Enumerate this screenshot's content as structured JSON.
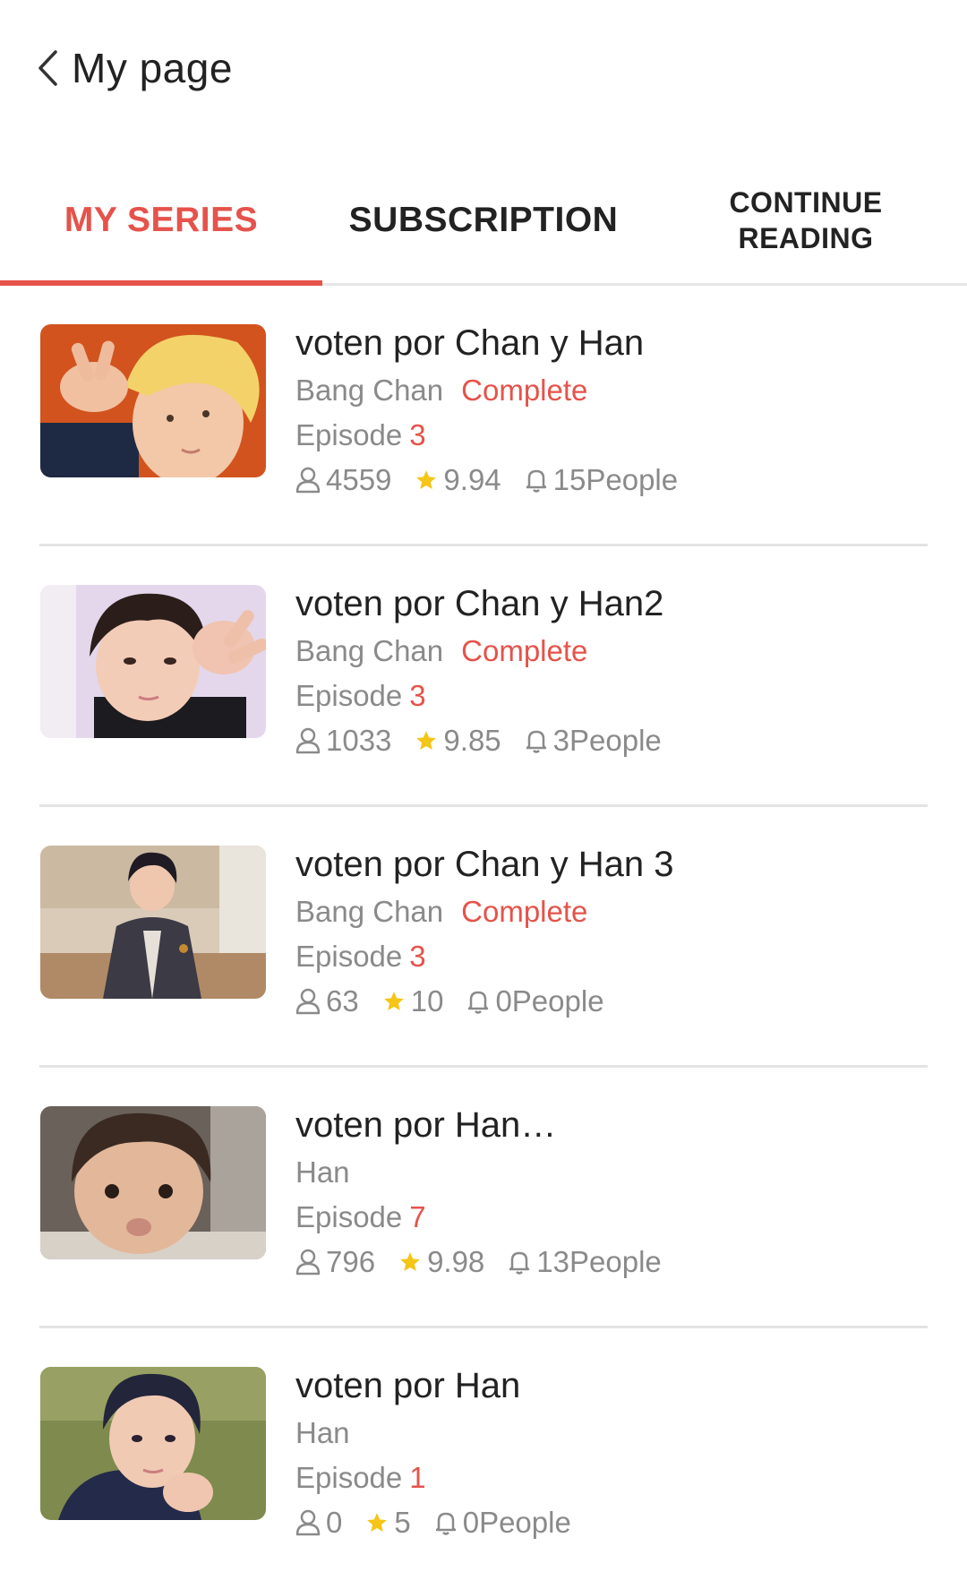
{
  "header": {
    "title": "My page",
    "back_icon": "chevron-left-icon"
  },
  "tabs": [
    {
      "label": "MY SERIES",
      "active": true
    },
    {
      "label": "SUBSCRIPTION",
      "active": false
    },
    {
      "label": "CONTINUE\nREADING",
      "active": false
    }
  ],
  "colors": {
    "accent": "#e5534b",
    "star": "#f5c518",
    "muted_text": "#8a8a8a",
    "divider": "#e3e3e3"
  },
  "series": [
    {
      "title": "voten por Chan y Han",
      "author": "Bang Chan",
      "status": "Complete",
      "episode_label": "Episode",
      "episode_num": "3",
      "views": "4559",
      "rating": "9.94",
      "subscribers": "15People"
    },
    {
      "title": "voten por Chan y Han2",
      "author": "Bang Chan",
      "status": "Complete",
      "episode_label": "Episode",
      "episode_num": "3",
      "views": "1033",
      "rating": "9.85",
      "subscribers": "3People"
    },
    {
      "title": "voten por Chan y Han 3",
      "author": "Bang Chan",
      "status": "Complete",
      "episode_label": "Episode",
      "episode_num": "3",
      "views": "63",
      "rating": "10",
      "subscribers": "0People"
    },
    {
      "title": "voten por Han…",
      "author": "Han",
      "status": "",
      "episode_label": "Episode",
      "episode_num": "7",
      "views": "796",
      "rating": "9.98",
      "subscribers": "13People"
    },
    {
      "title": "voten por Han",
      "author": "Han",
      "status": "",
      "episode_label": "Episode",
      "episode_num": "1",
      "views": "0",
      "rating": "5",
      "subscribers": "0People"
    }
  ],
  "icons": {
    "views": "person-icon",
    "rating": "star-icon",
    "subscribers": "bell-icon"
  }
}
